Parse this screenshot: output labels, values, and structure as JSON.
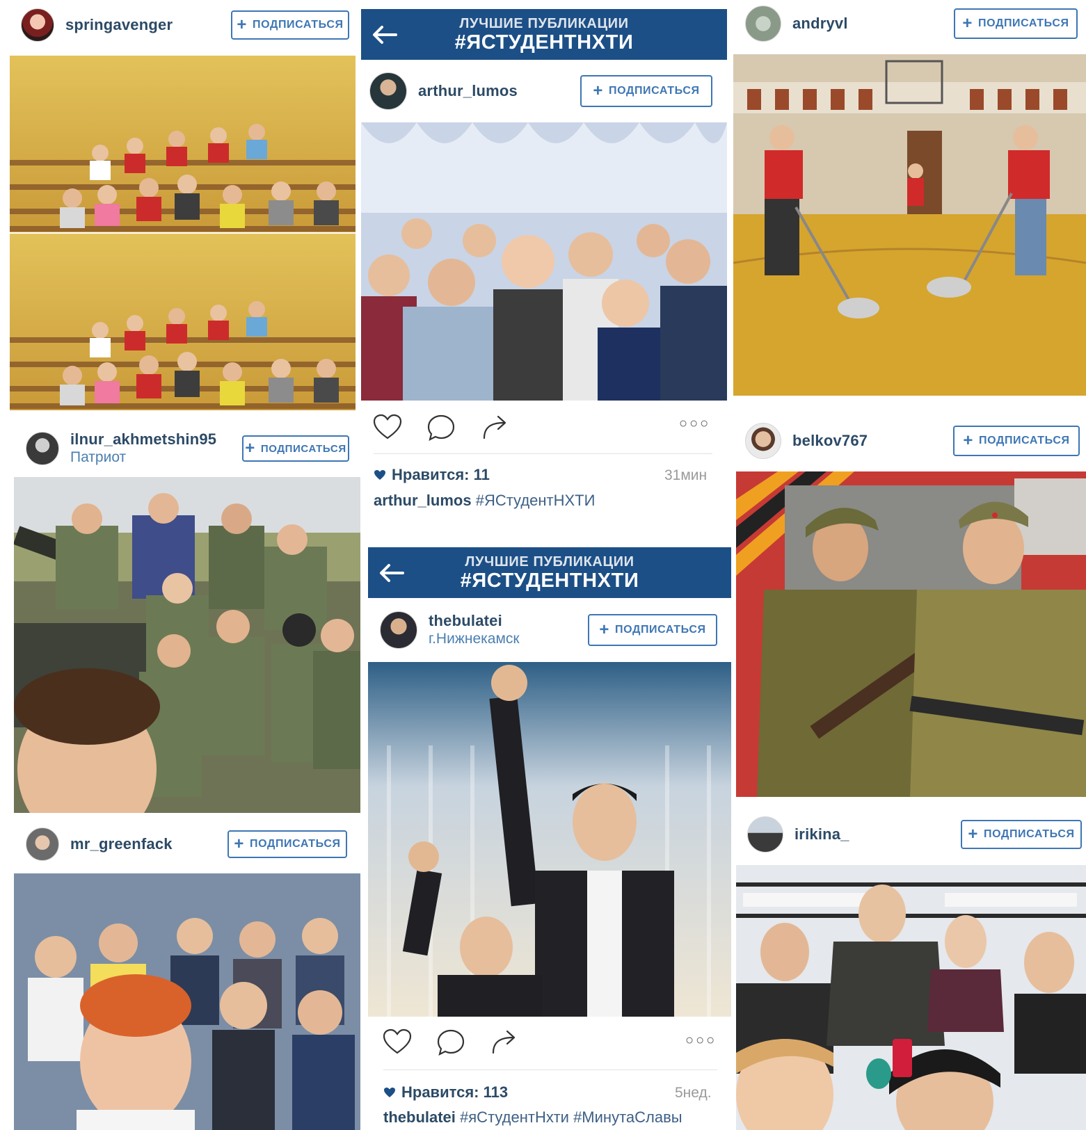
{
  "follow_label": "ПОДПИСАТЬСЯ",
  "banner": {
    "subtitle": "ЛУЧШИЕ ПУБЛИКАЦИИ",
    "title": "#ЯСТУДЕНТНХТИ"
  },
  "posts": {
    "springavenger": {
      "username": "springavenger"
    },
    "arthur_lumos": {
      "username": "arthur_lumos",
      "likes": "Нравится: 11",
      "time": "31мин",
      "caption_user": "arthur_lumos",
      "caption_text": "#ЯСтудентНХТИ"
    },
    "andryvl": {
      "username": "andryvl"
    },
    "ilnur": {
      "username": "ilnur_akhmetshin95",
      "location": "Патриот"
    },
    "belkov": {
      "username": "belkov767"
    },
    "thebulatei": {
      "username": "thebulatei",
      "location": "г.Нижнекамск",
      "likes": "Нравится: 113",
      "time": "5нед.",
      "caption_user": "thebulatei",
      "caption_text": "#яСтудентНхти #МинутаСлавы"
    },
    "mr_greenfack": {
      "username": "mr_greenfack"
    },
    "irikina": {
      "username": "irikina_"
    }
  },
  "icons": [
    "back-arrow-icon",
    "heart-icon",
    "comment-icon",
    "share-icon",
    "more-icon",
    "plus-icon",
    "filled-heart-icon"
  ],
  "colors": {
    "banner": "#1c4f86",
    "accent": "#3d76b4",
    "username": "#2c4a66",
    "location": "#4b7fb0"
  }
}
